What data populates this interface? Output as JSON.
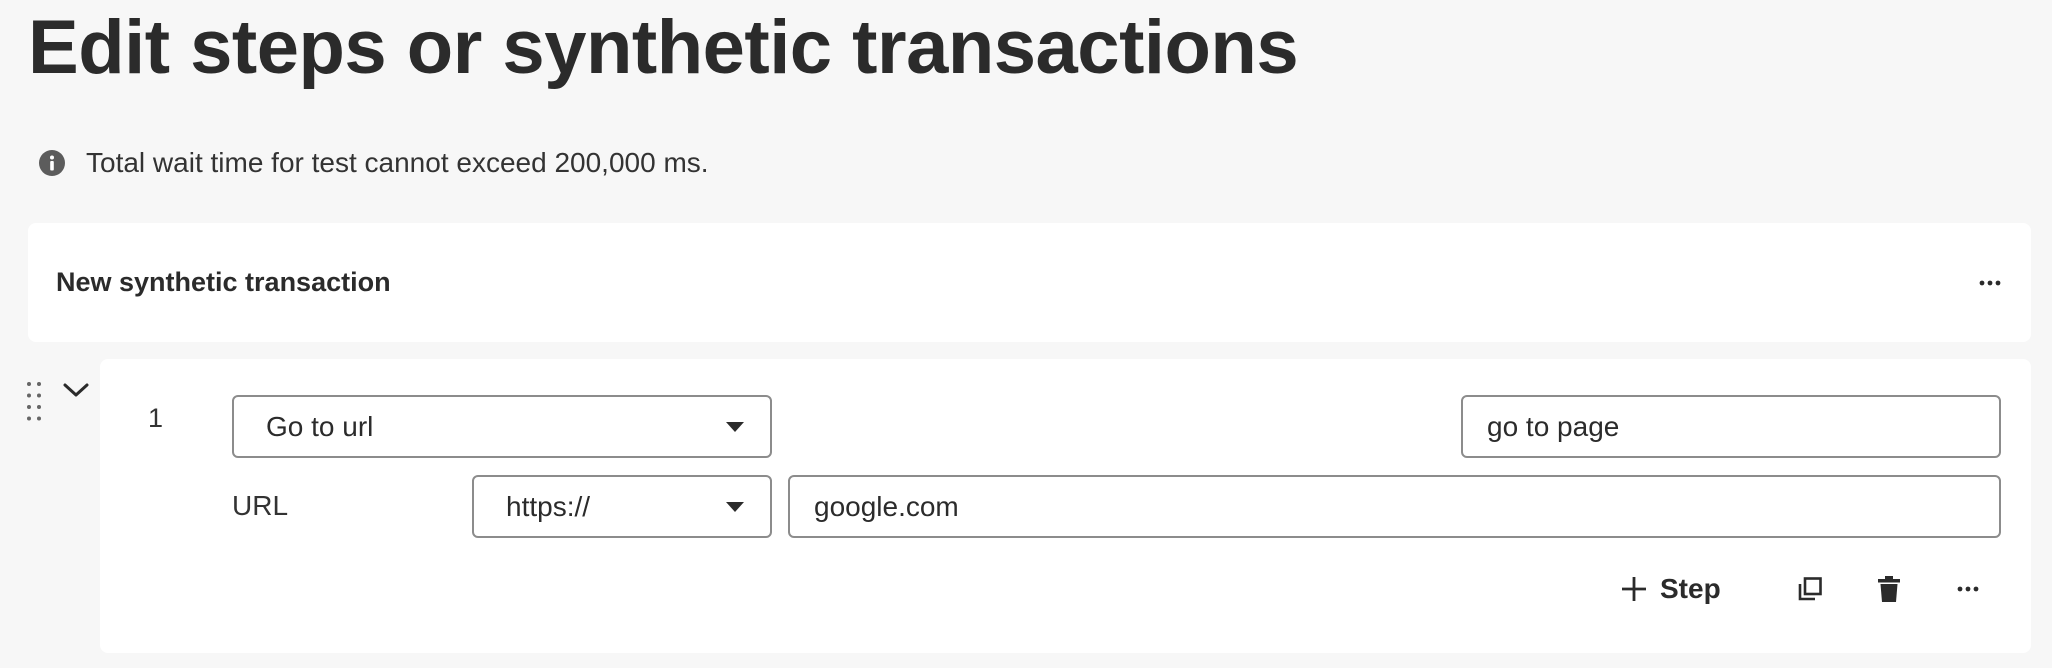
{
  "page": {
    "title": "Edit steps or synthetic transactions"
  },
  "notice": {
    "icon": "info-icon",
    "text": "Total wait time for test cannot exceed 200,000 ms."
  },
  "transaction": {
    "title": "New synthetic transaction",
    "more_icon": "more-horizontal-icon"
  },
  "step": {
    "number": "1",
    "action": {
      "selected": "Go to url"
    },
    "name": {
      "value": "go to page"
    },
    "url": {
      "label": "URL",
      "protocol": "https://",
      "value": "google.com"
    },
    "actions": {
      "add_step_label": "Step",
      "add_icon": "plus-icon",
      "duplicate_icon": "duplicate-icon",
      "delete_icon": "trash-icon",
      "more_icon": "more-horizontal-icon"
    }
  },
  "colors": {
    "background": "#f7f7f7",
    "card": "#ffffff",
    "text": "#2b2b2b",
    "border": "#8c8c8c"
  }
}
